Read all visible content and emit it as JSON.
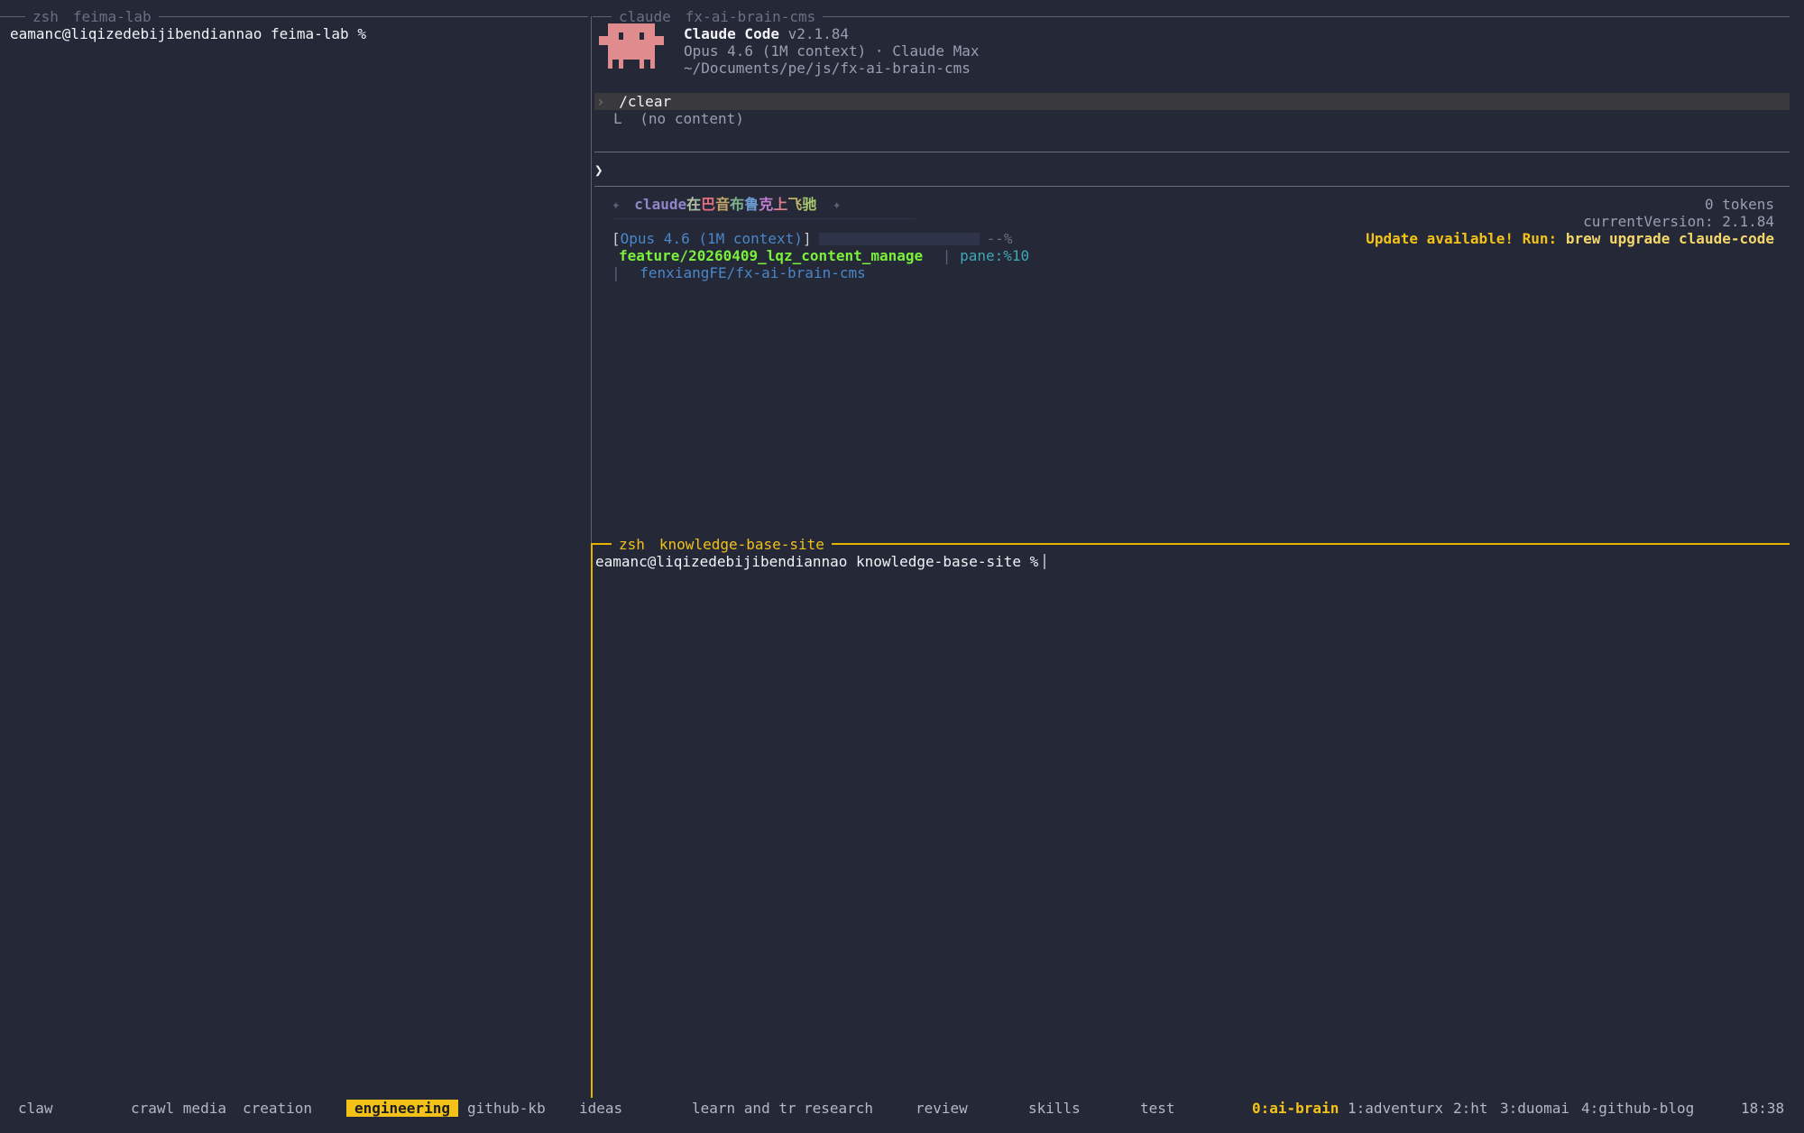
{
  "panes": {
    "left": {
      "title_cmd": "zsh",
      "title_dir": "feima-lab",
      "prompt": "eamanc@liqizedebijibendiannao feima-lab %"
    },
    "claude": {
      "title_cmd": "claude",
      "title_dir": "fx-ai-brain-cms",
      "app_name": "Claude Code",
      "app_version": "v2.1.84",
      "model_line": "Opus 4.6 (1M context) · Claude Max",
      "cwd": "~/Documents/pe/js/fx-ai-brain-cms",
      "prompt_glyph": "›",
      "history_command": "/clear",
      "history_result_glyph": "L",
      "history_result": "(no content)",
      "input_glyph": "❯",
      "banner_left": "✦",
      "banner_right": "✦",
      "banner_chars": [
        "c",
        "l",
        "a",
        "u",
        "d",
        "e",
        "在",
        "巴",
        "音",
        "布",
        "鲁",
        "克",
        "上",
        "飞",
        "驰"
      ],
      "banner_colors": [
        "#8e86c8",
        "#8e86c8",
        "#8e86c8",
        "#8e86c8",
        "#8e86c8",
        "#8e86c8",
        "#b2c2a6",
        "#e56f80",
        "#c4a46a",
        "#7fb18c",
        "#6f9bd4",
        "#c17fd1",
        "#d87f8f",
        "#c0b46a",
        "#a7c86f"
      ],
      "tokens": "0 tokens",
      "current_version": "currentVersion: 2.1.84",
      "update_prefix": "Update available! Run:",
      "update_command": "brew upgrade claude-code",
      "status_bracket_open": "[",
      "status_model": "Opus 4.6 (1M context)",
      "status_bracket_close": "]",
      "status_percent": "--%",
      "branch": "feature/20260409_lqz_content_manage",
      "pane_sep": "|",
      "pane_label": "pane:%10",
      "repo_sep": "|",
      "repo": "fenxiangFE/fx-ai-brain-cms"
    },
    "bottom": {
      "title_cmd": "zsh",
      "title_dir": "knowledge-base-site",
      "prompt": "eamanc@liqizedebijibendiannao knowledge-base-site %"
    }
  },
  "statusbar": {
    "sessions": [
      "claw",
      "crawl media",
      "creation",
      "engineering",
      "github-kb",
      "ideas",
      "learn and tr",
      "research",
      "review",
      "skills",
      "test"
    ],
    "active_session": "engineering",
    "windows": [
      "0:ai-brain",
      "1:adventurx",
      "2:ht",
      "3:duomai",
      "4:github-blog"
    ],
    "active_window": "0:ai-brain",
    "clock": "18:38"
  },
  "colors": {
    "background": "#242837",
    "accent_yellow": "#f3c218",
    "branch_green": "#7af03a",
    "model_blue": "#4a86c8",
    "pane_cyan": "#3fa7b5",
    "mascot": "#e08c8f"
  }
}
